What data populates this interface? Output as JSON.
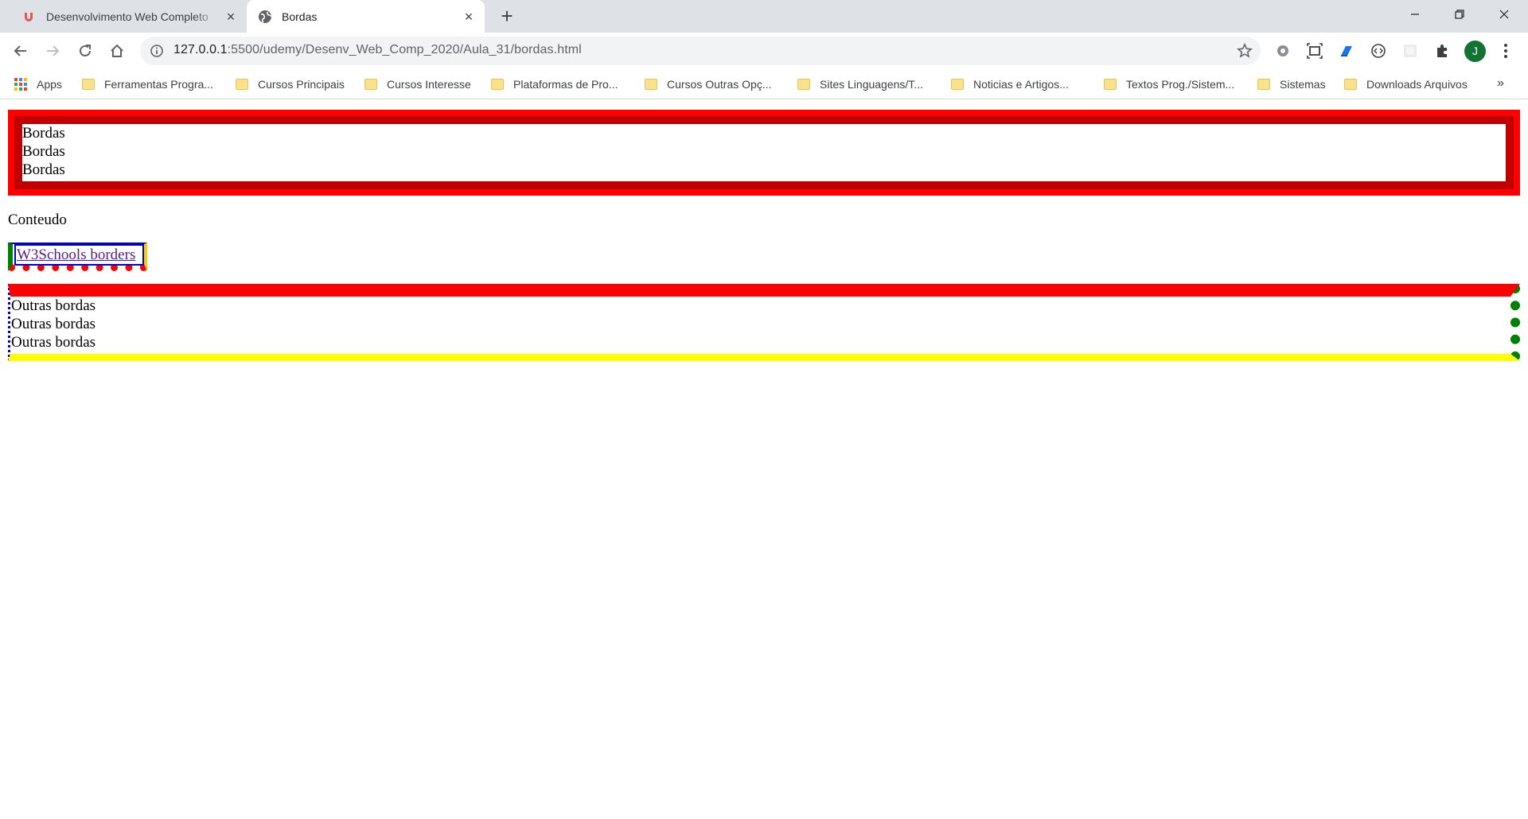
{
  "browser": {
    "tabs": [
      {
        "label": "Desenvolvimento Web Completo",
        "active": false,
        "icon": "udemy-icon"
      },
      {
        "label": "Bordas",
        "active": true,
        "icon": "globe-icon"
      }
    ],
    "url_host": "127.0.0.1",
    "url_path": ":5500/udemy/Desenv_Web_Comp_2020/Aula_31/bordas.html",
    "profile_initial": "J",
    "accent_color": "#137333"
  },
  "bookmarks": [
    {
      "label": "Apps"
    },
    {
      "label": "Ferramentas Progra..."
    },
    {
      "label": "Cursos Principais"
    },
    {
      "label": "Cursos Interesse"
    },
    {
      "label": "Plataformas de Pro..."
    },
    {
      "label": "Cursos Outras Opç..."
    },
    {
      "label": "Sites Linguagens/T..."
    },
    {
      "label": "Noticias e Artigos..."
    },
    {
      "label": "Textos Prog./Sistem..."
    },
    {
      "label": "Sistemas"
    },
    {
      "label": "Downloads Arquivos"
    }
  ],
  "bookmarks_overflow": "»",
  "content": {
    "bordas_lines": [
      "Bordas",
      "Bordas",
      "Bordas"
    ],
    "conteudo": "Conteudo",
    "link_text": "W3Schools borders",
    "outras_lines": [
      "Outras bordas",
      "Outras bordas",
      "Outras bordas"
    ]
  },
  "colors": {
    "red": "#ff0000",
    "dark_red": "#c00000",
    "blue": "#0000cc",
    "green": "#008000",
    "yellow": "#ffff00"
  }
}
